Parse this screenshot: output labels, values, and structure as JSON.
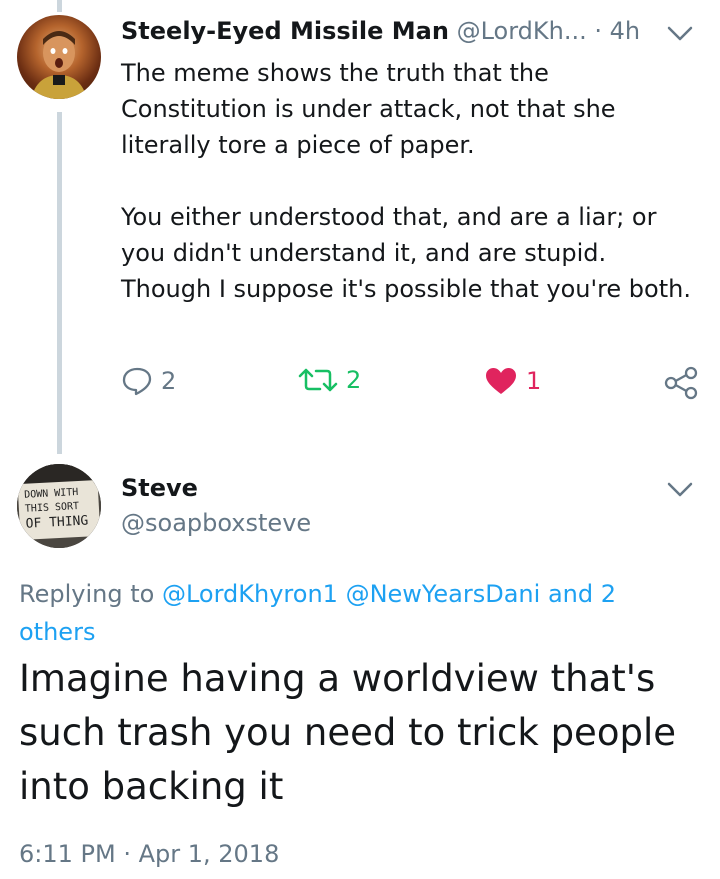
{
  "tweet1": {
    "author_name": "Steely-Eyed Missile Man",
    "author_handle": "@LordKh...",
    "separator": "·",
    "time": "4h",
    "paragraph1": "The meme shows the truth that the Constitution is under attack, not that she literally tore a piece of paper.",
    "paragraph2": "You either understood that, and are a liar; or you didn't understand it, and are stupid. Though I suppose it's possible that you're both.",
    "reply_count": "2",
    "retweet_count": "2",
    "like_count": "1",
    "colors": {
      "retweet": "#17bf63",
      "like": "#e0245e",
      "muted": "#657786"
    },
    "icons": [
      "reply-icon",
      "retweet-icon",
      "heart-icon",
      "share-icon",
      "chevron-down-icon"
    ]
  },
  "tweet2": {
    "author_name": "Steve",
    "author_handle": "@soapboxsteve",
    "avatar_sign": "DOWN WITH THIS SORT OF THING",
    "replying_prefix": "Replying to",
    "mention1": "@LordKhyron1",
    "mention2": "@NewYearsDani",
    "mention_suffix": "and 2 others",
    "text": "Imagine having a worldview that's such trash you need to trick people into backing it",
    "timestamp": "6:11 PM · Apr 1, 2018",
    "colors": {
      "link": "#1da1f2"
    }
  }
}
